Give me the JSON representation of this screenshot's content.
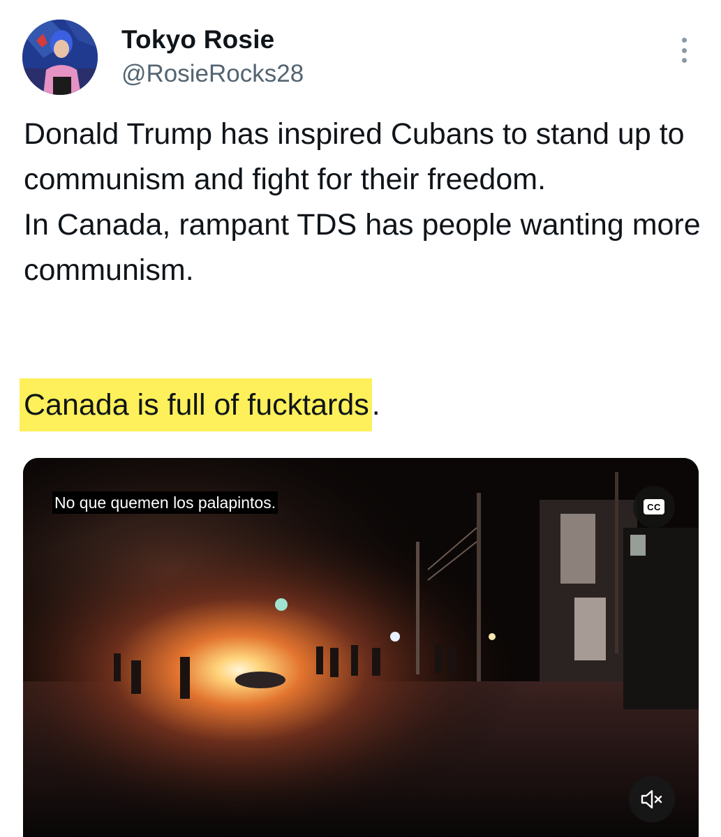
{
  "author": {
    "display_name": "Tokyo Rosie",
    "handle": "@RosieRocks28",
    "avatar_icon": "profile-avatar"
  },
  "menu": {
    "icon": "more-vertical-icon"
  },
  "tweet": {
    "paragraphs": [
      "Donald Trump has inspired Cubans to stand up to communism and fight for their freedom.",
      "In Canada, rampant TDS has people wanting more communism."
    ],
    "highlighted_text": "Canada is full of fucktards",
    "highlighted_suffix": ".",
    "highlight_color": "#fdf05a"
  },
  "video": {
    "caption": "No que quemen los palapintos.",
    "cc_label": "CC",
    "cc_icon": "closed-captions-icon",
    "mute_icon": "volume-muted-icon"
  }
}
